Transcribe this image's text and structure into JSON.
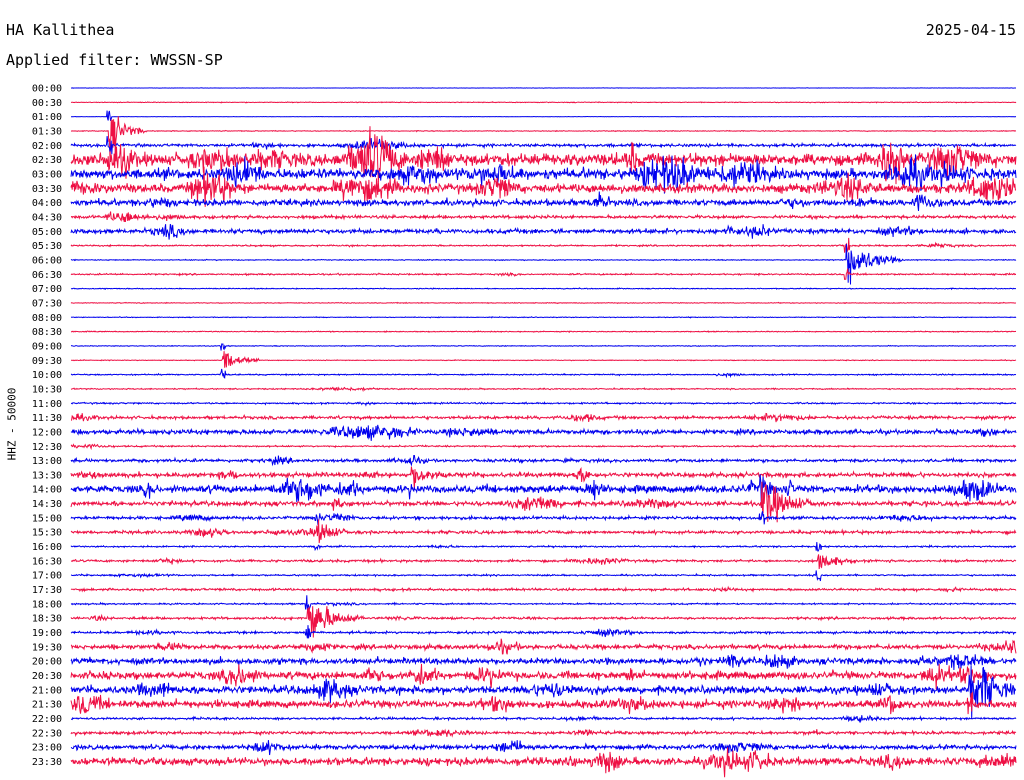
{
  "header": {
    "station": "HA Kallithea",
    "date": "2025-04-15",
    "filter": "Applied filter: WWSSN-SP"
  },
  "chart_data": {
    "type": "line",
    "title": "HA Kallithea",
    "ylabel": "HHZ - 50000",
    "row_labels": [
      "00:00",
      "00:30",
      "01:00",
      "01:30",
      "02:00",
      "02:30",
      "03:00",
      "03:30",
      "04:00",
      "04:30",
      "05:00",
      "05:30",
      "06:00",
      "06:30",
      "07:00",
      "07:30",
      "08:00",
      "08:30",
      "09:00",
      "09:30",
      "10:00",
      "10:30",
      "11:00",
      "11:30",
      "12:00",
      "12:30",
      "13:00",
      "13:30",
      "14:00",
      "14:30",
      "15:00",
      "15:30",
      "16:00",
      "16:30",
      "17:00",
      "17:30",
      "18:00",
      "18:30",
      "19:00",
      "19:30",
      "20:00",
      "20:30",
      "21:00",
      "21:30",
      "22:00",
      "22:30",
      "23:00",
      "23:30"
    ],
    "trace_colors": [
      "#0000ee",
      "#ee1044"
    ],
    "row_noise": [
      0.2,
      0.5,
      0.2,
      0.5,
      2,
      8,
      7,
      6,
      4,
      2,
      3,
      1,
      0.6,
      1,
      0.6,
      0.5,
      0.5,
      0.6,
      0.5,
      0.5,
      0.8,
      0.8,
      1,
      2,
      3,
      1,
      2,
      3,
      5,
      3,
      2,
      2,
      1,
      1.5,
      1,
      1.5,
      1,
      1.5,
      1.5,
      3,
      4,
      5,
      5,
      5,
      1.5,
      2,
      3,
      5
    ],
    "events": [
      {
        "start": "01:30",
        "x_fraction": 0.04,
        "amplitude": 40,
        "duration_fraction": 0.02
      },
      {
        "start": "06:00",
        "x_fraction": 0.82,
        "amplitude": 40,
        "duration_fraction": 0.03
      },
      {
        "start": "09:30",
        "x_fraction": 0.16,
        "amplitude": 20,
        "duration_fraction": 0.02
      },
      {
        "start": "13:30",
        "x_fraction": 0.36,
        "amplitude": 20,
        "duration_fraction": 0.02
      },
      {
        "start": "14:30",
        "x_fraction": 0.73,
        "amplitude": 40,
        "duration_fraction": 0.03
      },
      {
        "start": "15:30",
        "x_fraction": 0.26,
        "amplitude": 20,
        "duration_fraction": 0.02
      },
      {
        "start": "16:30",
        "x_fraction": 0.79,
        "amplitude": 18,
        "duration_fraction": 0.02
      },
      {
        "start": "18:30",
        "x_fraction": 0.25,
        "amplitude": 40,
        "duration_fraction": 0.03
      },
      {
        "start": "21:00",
        "x_fraction": 0.95,
        "amplitude": 40,
        "duration_fraction": 0.03
      }
    ]
  }
}
